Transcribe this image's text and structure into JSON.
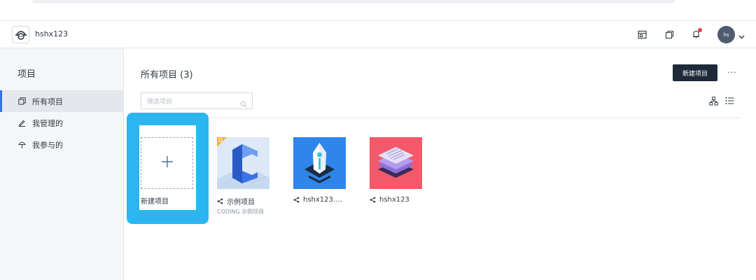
{
  "header": {
    "team_name": "hshx123",
    "avatar_initials": "hs"
  },
  "sidebar": {
    "title": "项目",
    "items": [
      {
        "label": "所有项目",
        "icon": "copy-icon",
        "active": true
      },
      {
        "label": "我管理的",
        "icon": "pencil-icon",
        "active": false
      },
      {
        "label": "我参与的",
        "icon": "umbrella-icon",
        "active": false
      }
    ]
  },
  "main": {
    "title": "所有项目 (3)",
    "new_button": "新建项目",
    "more": "···",
    "filter_placeholder": "筛选项目"
  },
  "cards": {
    "new_card_label": "新建项目",
    "projects": [
      {
        "name": "示例项目",
        "sub": "CODING 示例项目",
        "shared": true
      },
      {
        "name": "hshx123.…",
        "sub": "",
        "shared": true
      },
      {
        "name": "hshx123",
        "sub": "",
        "shared": true
      }
    ]
  },
  "colors": {
    "accent": "#3670f2",
    "highlight": "#2bb6f0",
    "dark_button": "#1e2a3a",
    "notification_dot": "#e5434c"
  }
}
